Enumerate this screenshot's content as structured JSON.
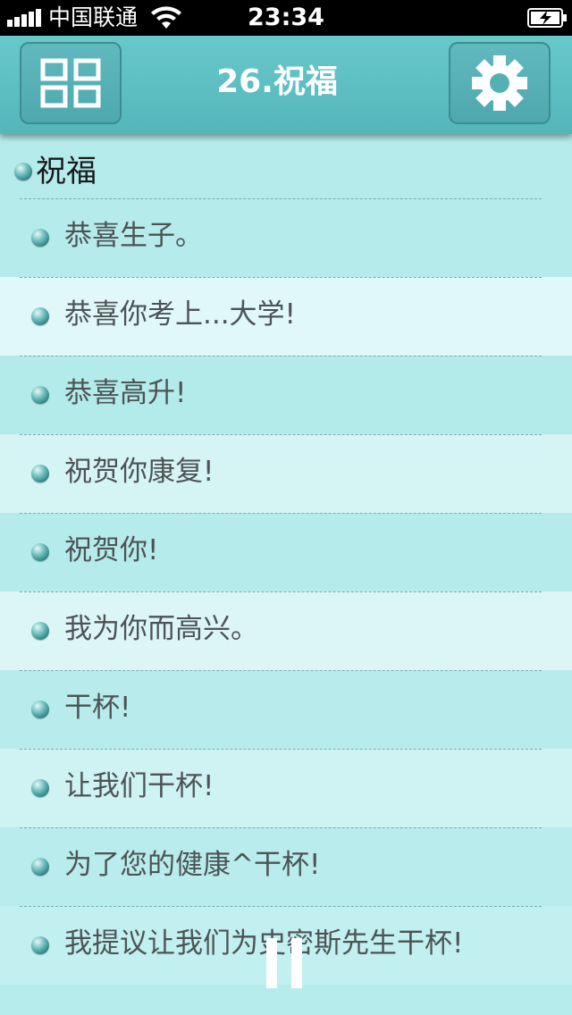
{
  "status_bar": {
    "carrier": "中国联通",
    "time": "23:34"
  },
  "nav": {
    "title": "26.祝福",
    "left_icon": "grid-menu-icon",
    "right_icon": "gear-icon"
  },
  "section": {
    "title": "祝福"
  },
  "items": [
    {
      "text": "恭喜生子。"
    },
    {
      "text": "恭喜你考上...大学!"
    },
    {
      "text": "恭喜高升!"
    },
    {
      "text": "祝贺你康复!"
    },
    {
      "text": "祝贺你!"
    },
    {
      "text": "我为你而高兴。"
    },
    {
      "text": "干杯!"
    },
    {
      "text": "让我们干杯!"
    },
    {
      "text": "为了您的健康^干杯!"
    },
    {
      "text": "我提议让我们为史密斯先生干杯!"
    }
  ],
  "row_colors": [
    "#b5ebeb",
    "#e0f8f8",
    "#b3eaea",
    "#d5f4f4",
    "#b5ebeb",
    "#dcf6f6",
    "#b8ecec",
    "#cff2f2",
    "#b9ecec",
    "#c2efef"
  ],
  "playback": {
    "icon": "pause-icon"
  }
}
